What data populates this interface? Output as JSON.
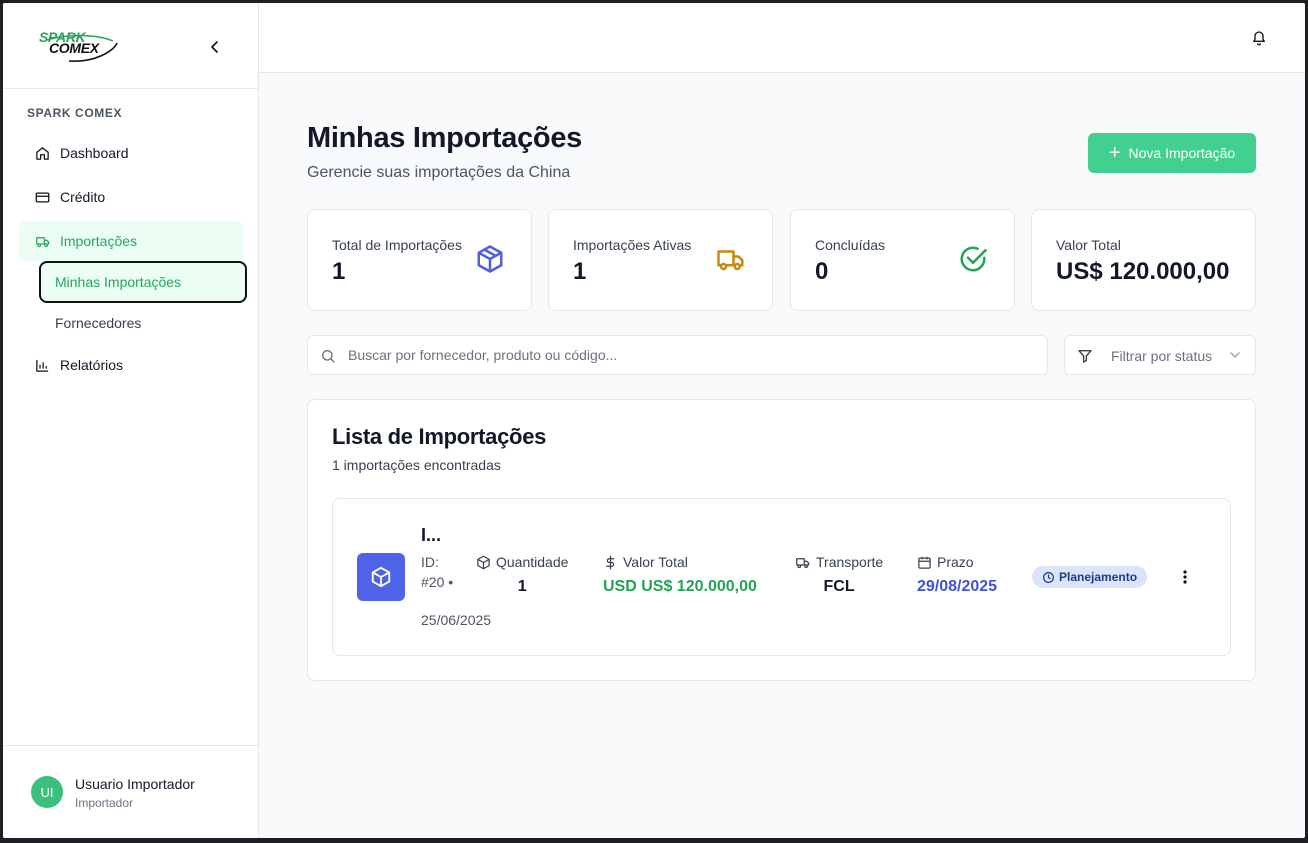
{
  "brand": {
    "line1": "SPARK",
    "line2": "COMEX",
    "accent": "#27a35a"
  },
  "sidebar": {
    "section_label": "SPARK COMEX",
    "items": [
      {
        "label": "Dashboard",
        "icon": "home-icon"
      },
      {
        "label": "Crédito",
        "icon": "credit-card-icon"
      },
      {
        "label": "Importações",
        "icon": "truck-icon",
        "active": true
      },
      {
        "label": "Relatórios",
        "icon": "bar-chart-icon"
      }
    ],
    "sub_items": [
      {
        "label": "Minhas Importações",
        "current": true
      },
      {
        "label": "Fornecedores"
      }
    ]
  },
  "user": {
    "initials": "UI",
    "name": "Usuario Importador",
    "role": "Importador"
  },
  "header": {
    "bell_icon": "bell-icon"
  },
  "page": {
    "title": "Minhas Importações",
    "subtitle": "Gerencie suas importações da China",
    "new_button": "Nova Importação"
  },
  "stats": [
    {
      "label": "Total de Importações",
      "value": "1",
      "icon": "package-icon",
      "color": "#4f5fe0"
    },
    {
      "label": "Importações Ativas",
      "value": "1",
      "icon": "truck-icon",
      "color": "#c98a0a"
    },
    {
      "label": "Concluídas",
      "value": "0",
      "icon": "check-circle-icon",
      "color": "#23a455"
    },
    {
      "label": "Valor Total",
      "value": "US$ 120.000,00"
    }
  ],
  "search": {
    "placeholder": "Buscar por fornecedor, produto ou código..."
  },
  "filter": {
    "label": "Filtrar por status"
  },
  "list": {
    "title": "Lista de Importações",
    "count_text": "1 importações encontradas",
    "rows": [
      {
        "name": "I...",
        "id_text": "ID: #20 •",
        "date": "25/06/2025",
        "quantity_label": "Quantidade",
        "quantity": "1",
        "value_label": "Valor Total",
        "value": "USD US$ 120.000,00",
        "transport_label": "Transporte",
        "transport": "FCL",
        "deadline_label": "Prazo",
        "deadline": "29/08/2025",
        "status": "Planejamento"
      }
    ]
  },
  "colors": {
    "green": "#41d08f",
    "value_green": "#23a455",
    "deadline_blue": "#4250d8"
  }
}
